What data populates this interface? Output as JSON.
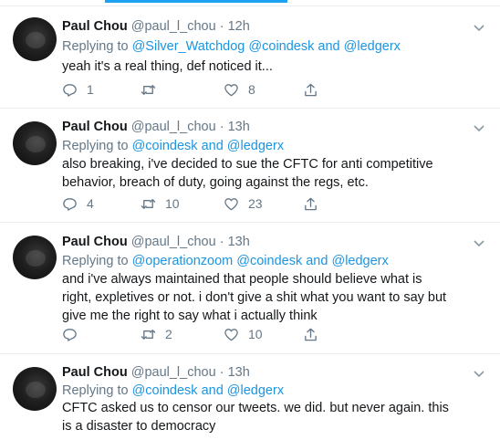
{
  "tweets": [
    {
      "name": "Paul Chou",
      "handle": "@paul_l_chou",
      "time": "12h",
      "replying_prefix": "Replying to",
      "mentions": [
        "@Silver_Watchdog",
        "@coindesk",
        "@ledgerx"
      ],
      "text": "yeah it's a real thing, def noticed it...",
      "replies": "1",
      "retweets": "",
      "likes": "8"
    },
    {
      "name": "Paul Chou",
      "handle": "@paul_l_chou",
      "time": "13h",
      "replying_prefix": "Replying to",
      "mentions": [
        "@coindesk",
        "@ledgerx"
      ],
      "text": "also breaking, i've decided to sue the CFTC for anti competitive behavior, breach of duty, going against the regs, etc.",
      "replies": "4",
      "retweets": "10",
      "likes": "23"
    },
    {
      "name": "Paul Chou",
      "handle": "@paul_l_chou",
      "time": "13h",
      "replying_prefix": "Replying to",
      "mentions": [
        "@operationzoom",
        "@coindesk",
        "@ledgerx"
      ],
      "text": "and i've always maintained that people should believe what is right, expletives or not. i don't give a shit what you want to say but give me the right to say what i actually think",
      "replies": "",
      "retweets": "2",
      "likes": "10"
    },
    {
      "name": "Paul Chou",
      "handle": "@paul_l_chou",
      "time": "13h",
      "replying_prefix": "Replying to",
      "mentions": [
        "@coindesk",
        "@ledgerx"
      ],
      "text": "CFTC asked us to censor our tweets. we did. but never again. this is a disaster to democracy",
      "replies": "",
      "retweets": "",
      "likes": ""
    }
  ],
  "joiners": {
    "and": "and"
  },
  "icons": {
    "reply": "reply-icon",
    "retweet": "retweet-icon",
    "like": "heart-icon",
    "share": "share-icon",
    "caret": "chevron-down-icon"
  },
  "colors": {
    "link": "#1b95e0",
    "meta": "#657786",
    "accent": "#1da1f2"
  }
}
